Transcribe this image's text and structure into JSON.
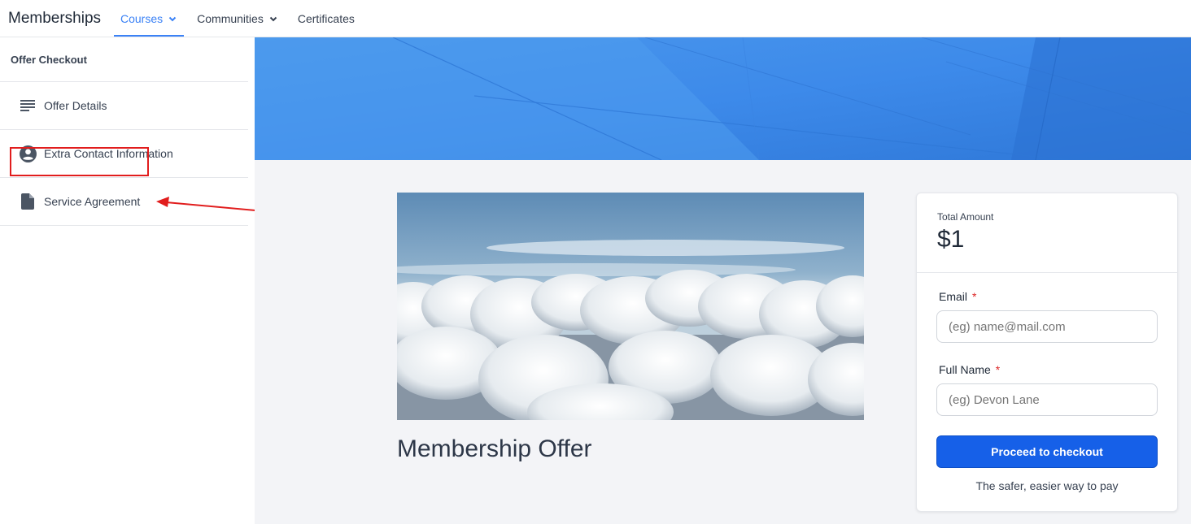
{
  "nav": {
    "brand": "Memberships",
    "items": [
      {
        "label": "Courses",
        "active": true,
        "dropdown": true
      },
      {
        "label": "Communities",
        "active": false,
        "dropdown": true
      },
      {
        "label": "Certificates",
        "active": false,
        "dropdown": false
      }
    ]
  },
  "sidebar": {
    "title": "Offer Checkout",
    "items": [
      {
        "label": "Offer Details",
        "icon": "lines-icon"
      },
      {
        "label": "Extra Contact Information",
        "icon": "user-circle-icon"
      },
      {
        "label": "Service Agreement",
        "icon": "document-icon"
      }
    ]
  },
  "main": {
    "offer_title": "Membership Offer"
  },
  "checkout": {
    "total_label": "Total Amount",
    "total_value": "$1",
    "email_label": "Email",
    "email_placeholder": "(eg) name@mail.com",
    "name_label": "Full Name",
    "name_placeholder": "(eg) Devon Lane",
    "required_mark": "*",
    "button_label": "Proceed to checkout",
    "footnote": "The safer, easier way to pay"
  },
  "colors": {
    "accent": "#3b82f6",
    "button": "#1660e8",
    "required": "#dc2626",
    "annotation": "#e11d1d"
  }
}
